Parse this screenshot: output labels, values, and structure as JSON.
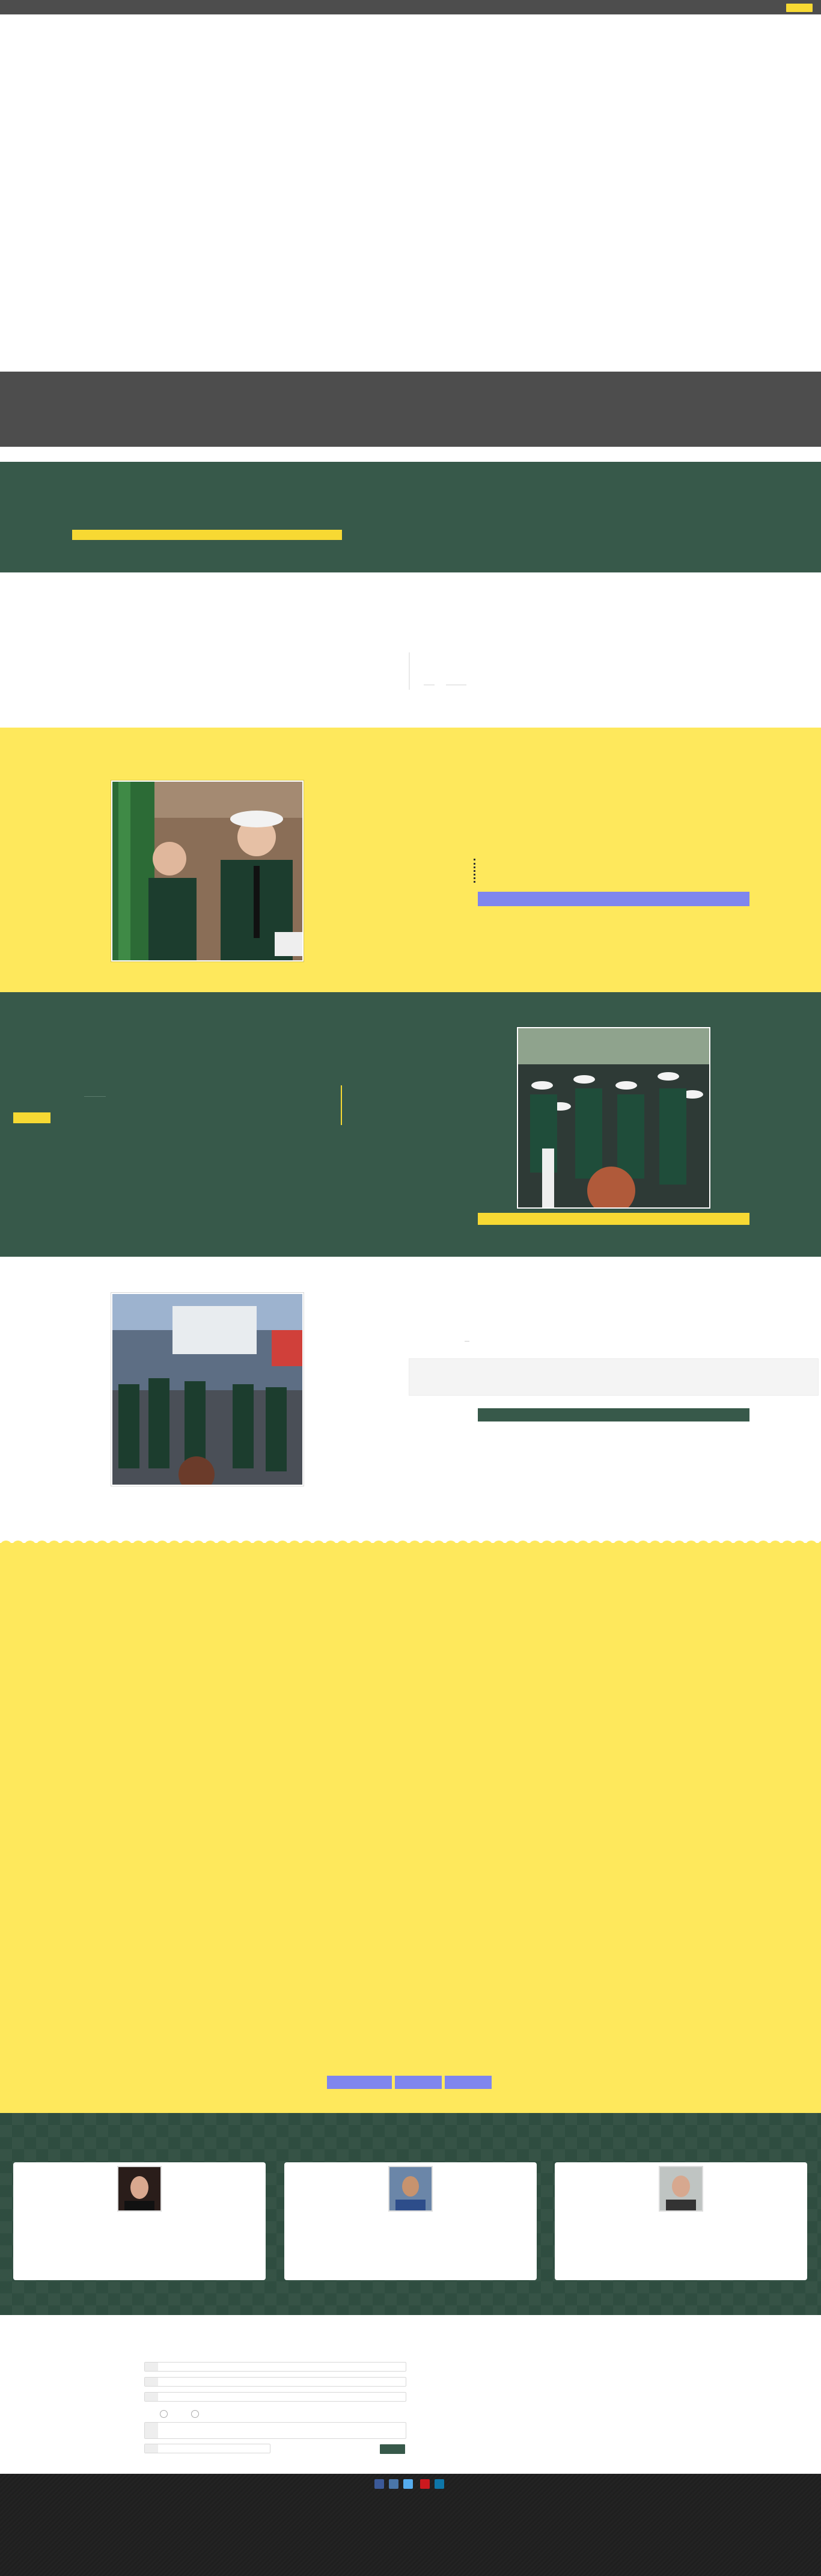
{
  "colors": {
    "dark_gray": "#4d4d4d",
    "brand_green": "#37594a",
    "brand_yellow": "#fee85c",
    "accent_yellow": "#f7d933",
    "periwinkle": "#7f86ee",
    "footer_dark": "#1f1f1f"
  },
  "icons": {
    "social": [
      "facebook-icon",
      "twitter-icon",
      "linkedin-icon",
      "youtube-icon",
      "instagram-icon"
    ]
  },
  "social_colors": [
    "#3b5998",
    "#4a76a8",
    "#55acee",
    "#cc181e",
    "#0e76a8"
  ]
}
